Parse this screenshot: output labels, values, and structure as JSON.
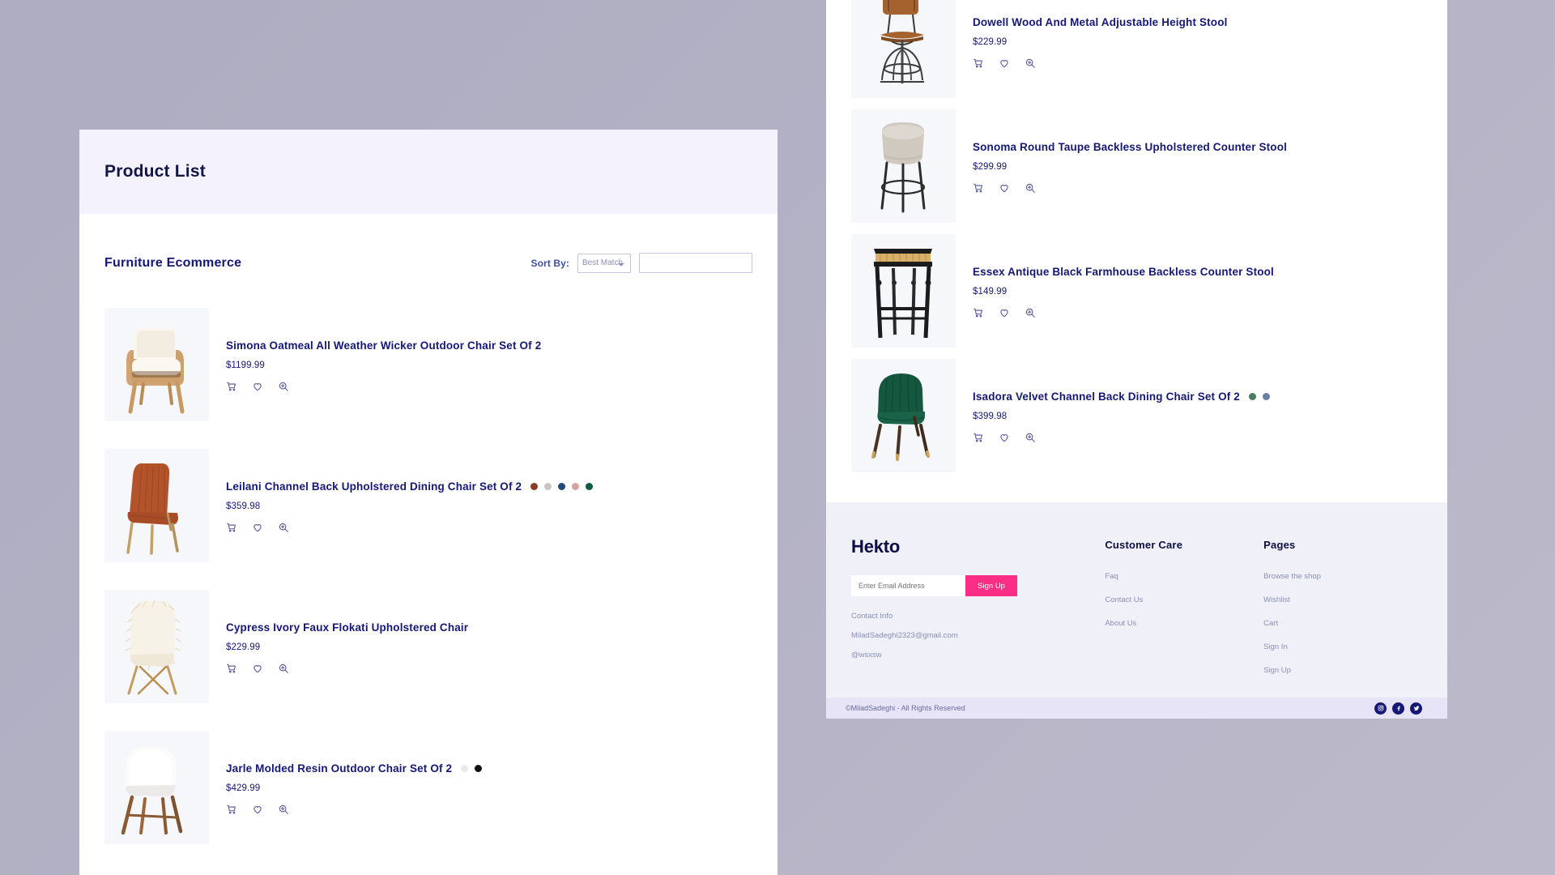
{
  "page": {
    "background_color": "#b1afc2"
  },
  "left_panel": {
    "header": {
      "title": "Product List",
      "background_color": "#f4f2fd"
    },
    "toolbar": {
      "heading": "Furniture Ecommerce",
      "sort_label": "Sort By:",
      "sort_selected": "Best Match",
      "sort_options": [
        "Best Match"
      ],
      "search_value": "",
      "search_placeholder": ""
    },
    "products": [
      {
        "title": "Simona Oatmeal All Weather Wicker Outdoor Chair Set Of 2",
        "price": "$1199.99",
        "swatches": [],
        "image": "wicker-armchair"
      },
      {
        "title": "Leilani Channel Back Upholstered Dining Chair Set Of 2",
        "price": "$359.98",
        "swatches": [
          "#8e3a25",
          "#cbc4c4",
          "#1f4a75",
          "#d8a0a3",
          "#0f5a44"
        ],
        "image": "rust-dining-chair"
      },
      {
        "title": "Cypress Ivory Faux Flokati Upholstered Chair",
        "price": "$229.99",
        "swatches": [],
        "image": "flokati-chair"
      },
      {
        "title": "Jarle Molded Resin Outdoor Chair Set Of 2",
        "price": "$429.99",
        "swatches": [
          "#e9e9ec",
          "#111111"
        ],
        "image": "resin-chair"
      }
    ]
  },
  "right_panel": {
    "products": [
      {
        "title": "Dowell Wood And Metal Adjustable Height Stool",
        "price": "$229.99",
        "swatches": [],
        "image": "wood-metal-stool"
      },
      {
        "title": "Sonoma Round Taupe Backless Upholstered Counter Stool",
        "price": "$299.99",
        "swatches": [],
        "image": "taupe-stool"
      },
      {
        "title": "Essex Antique Black Farmhouse Backless Counter Stool",
        "price": "$149.99",
        "swatches": [],
        "image": "black-farmhouse-stool"
      },
      {
        "title": "Isadora Velvet Channel Back Dining Chair Set Of 2",
        "price": "$399.98",
        "swatches": [
          "#4b7a5e",
          "#6a7fa8"
        ],
        "image": "green-velvet-chair"
      }
    ]
  },
  "footer": {
    "brand": "Hekto",
    "newsletter": {
      "placeholder": "Enter Email Address",
      "value": "",
      "button_label": "Sign Up",
      "button_color": "#fb2e86"
    },
    "contact_label": "Contact Info",
    "contact_email": "MiladSadeghi2323@gmail.com",
    "contact_handle": "@wsxsw",
    "columns": [
      {
        "title": "Customer Care",
        "links": [
          "Faq",
          "Contact Us",
          "About Us"
        ]
      },
      {
        "title": "Pages",
        "links": [
          "Browse the shop",
          "Wishlist",
          "Cart",
          "Sign In",
          "Sign Up"
        ]
      }
    ],
    "bottom": {
      "copyright": "©MiladSadeghi - All Rights Reserved",
      "socials": [
        "instagram-icon",
        "facebook-icon",
        "twitter-icon"
      ]
    }
  },
  "icons": {
    "cart": "cart-icon",
    "wishlist": "heart-icon",
    "quickview": "zoom-icon"
  }
}
